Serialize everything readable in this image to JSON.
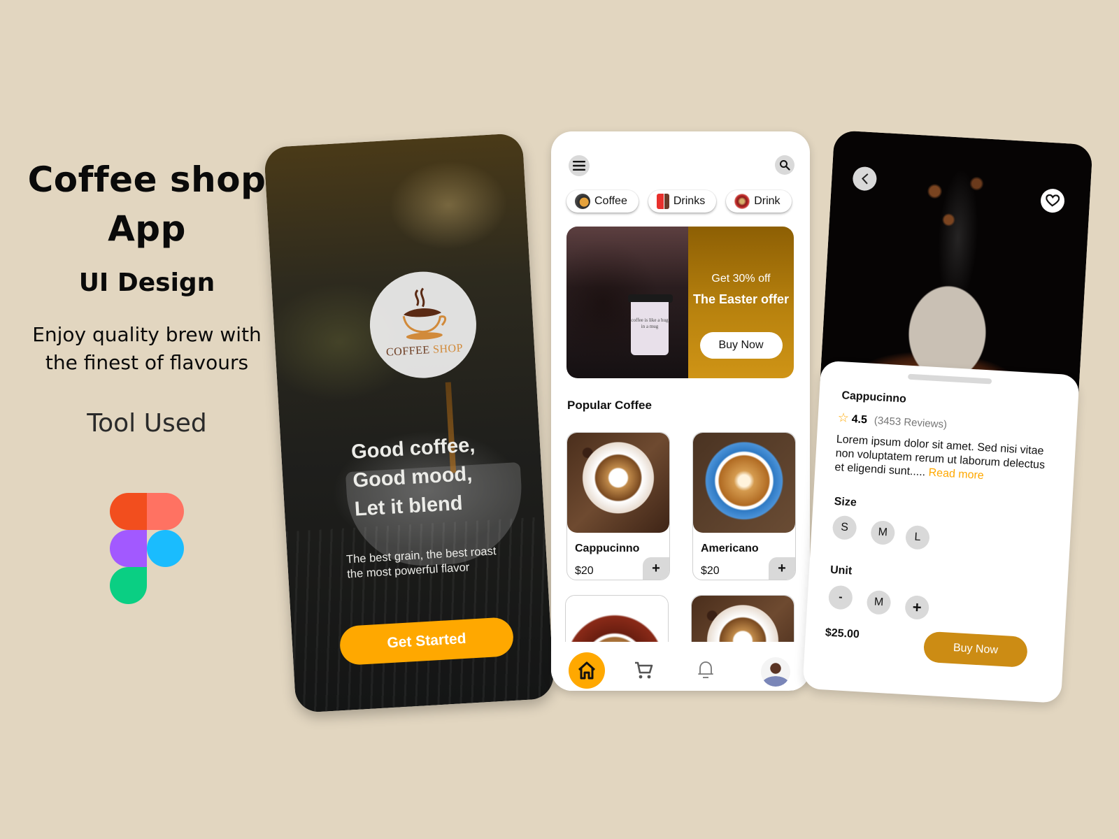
{
  "intro": {
    "title_line1": "Coffee shop",
    "title_line2": "App",
    "subtitle": "UI Design",
    "tagline": "Enjoy quality brew with the finest of flavours",
    "tool_label": "Tool Used",
    "tool_icon": "figma-logo",
    "figma_colors": [
      "#F24E1E",
      "#FF7262",
      "#A259FF",
      "#1ABCFE",
      "#0ACF83"
    ]
  },
  "splash": {
    "logo_word1": "COFFEE",
    "logo_word2": "SHOP",
    "headline_line1": "Good coffee,",
    "headline_line2": "Good mood,",
    "headline_line3": "Let it blend",
    "subline_line1": "The best grain, the best roast",
    "subline_line2": "the most powerful flavor",
    "cta_label": "Get Started",
    "accent": "#FFA800"
  },
  "home": {
    "menu_icon": "hamburger-menu-icon",
    "search_icon": "search-icon",
    "categories": [
      {
        "label": "Coffee",
        "icon": "coffee-cup-icon"
      },
      {
        "label": "Drinks",
        "icon": "drinks-icon"
      },
      {
        "label": "Drink",
        "icon": "drink-platter-icon"
      }
    ],
    "banner": {
      "cup_text": "coffee is like a hug in a mug",
      "promo_small": "Get 30% off",
      "promo_big": "The Easter offer",
      "button_label": "Buy Now",
      "color": "#B8820E"
    },
    "section_title": "Popular Coffee",
    "products": [
      {
        "name": "Cappucinno",
        "price": "$20",
        "add_label": "+"
      },
      {
        "name": "Americano",
        "price": "$20",
        "add_label": "+"
      },
      {
        "name": "",
        "price": "",
        "add_label": ""
      },
      {
        "name": "",
        "price": "",
        "add_label": ""
      }
    ],
    "nav": [
      {
        "name": "home",
        "icon": "home-icon",
        "active": true
      },
      {
        "name": "cart",
        "icon": "cart-icon",
        "active": false
      },
      {
        "name": "notifications",
        "icon": "bell-icon",
        "active": false
      },
      {
        "name": "profile",
        "icon": "avatar",
        "active": false
      }
    ]
  },
  "detail": {
    "back_icon": "chevron-left-icon",
    "favorite_icon": "heart-icon",
    "name": "Cappucinno",
    "rating": "4.5",
    "reviews": "(3453 Reviews)",
    "description": "Lorem ipsum dolor sit amet. Sed nisi vitae non voluptatem rerum ut laborum delectus et eligendi sunt.....",
    "read_more": "Read more",
    "size_label": "Size",
    "sizes": [
      "S",
      "M",
      "L"
    ],
    "unit_label": "Unit",
    "unit_minus": "-",
    "unit_value": "M",
    "unit_plus": "+",
    "price": "$25.00",
    "buy_label": "Buy Now",
    "buy_color": "#CC8C14"
  }
}
